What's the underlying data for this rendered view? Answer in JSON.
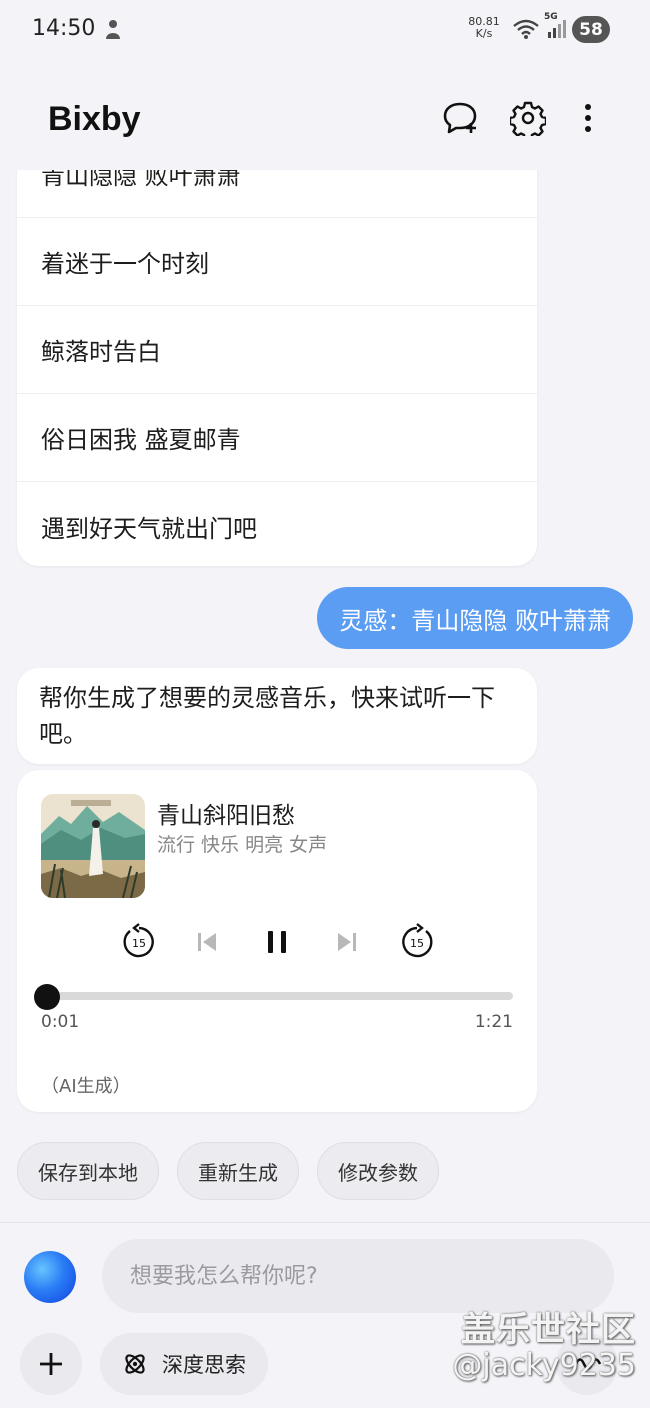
{
  "status_bar": {
    "time": "14:50",
    "net_speed_value": "80.81",
    "net_speed_unit": "K/s",
    "network_type": "5G",
    "battery": "58"
  },
  "header": {
    "title": "Bixby",
    "icons": [
      "new-chat-icon",
      "gear-icon",
      "more-vertical-icon"
    ]
  },
  "song_list": {
    "items": [
      "青山隐隐 败叶萧萧",
      "着迷于一个时刻",
      "鲸落时告白",
      "俗日困我 盛夏邮青",
      "遇到好天气就出门吧"
    ]
  },
  "user_message": "灵感：青山隐隐 败叶萧萧",
  "assistant_message": "帮你生成了想要的灵感音乐，快来试听一下吧。",
  "music_card": {
    "title": "青山斜阳旧愁",
    "tags": "流行 快乐 明亮 女声",
    "rewind_label": "15",
    "forward_label": "15",
    "elapsed": "0:01",
    "total": "1:21",
    "progress_fraction": 0.012,
    "ai_note": "（AI生成）"
  },
  "actions": {
    "save": "保存到本地",
    "regenerate": "重新生成",
    "modify": "修改参数"
  },
  "input": {
    "placeholder": "想要我怎么帮你呢?",
    "deep_think_label": "深度思索"
  },
  "watermark": {
    "site": "盖乐世社区",
    "user": "@jacky9235"
  },
  "colors": {
    "accent": "#5b9df3",
    "background": "#f4f4f8"
  }
}
